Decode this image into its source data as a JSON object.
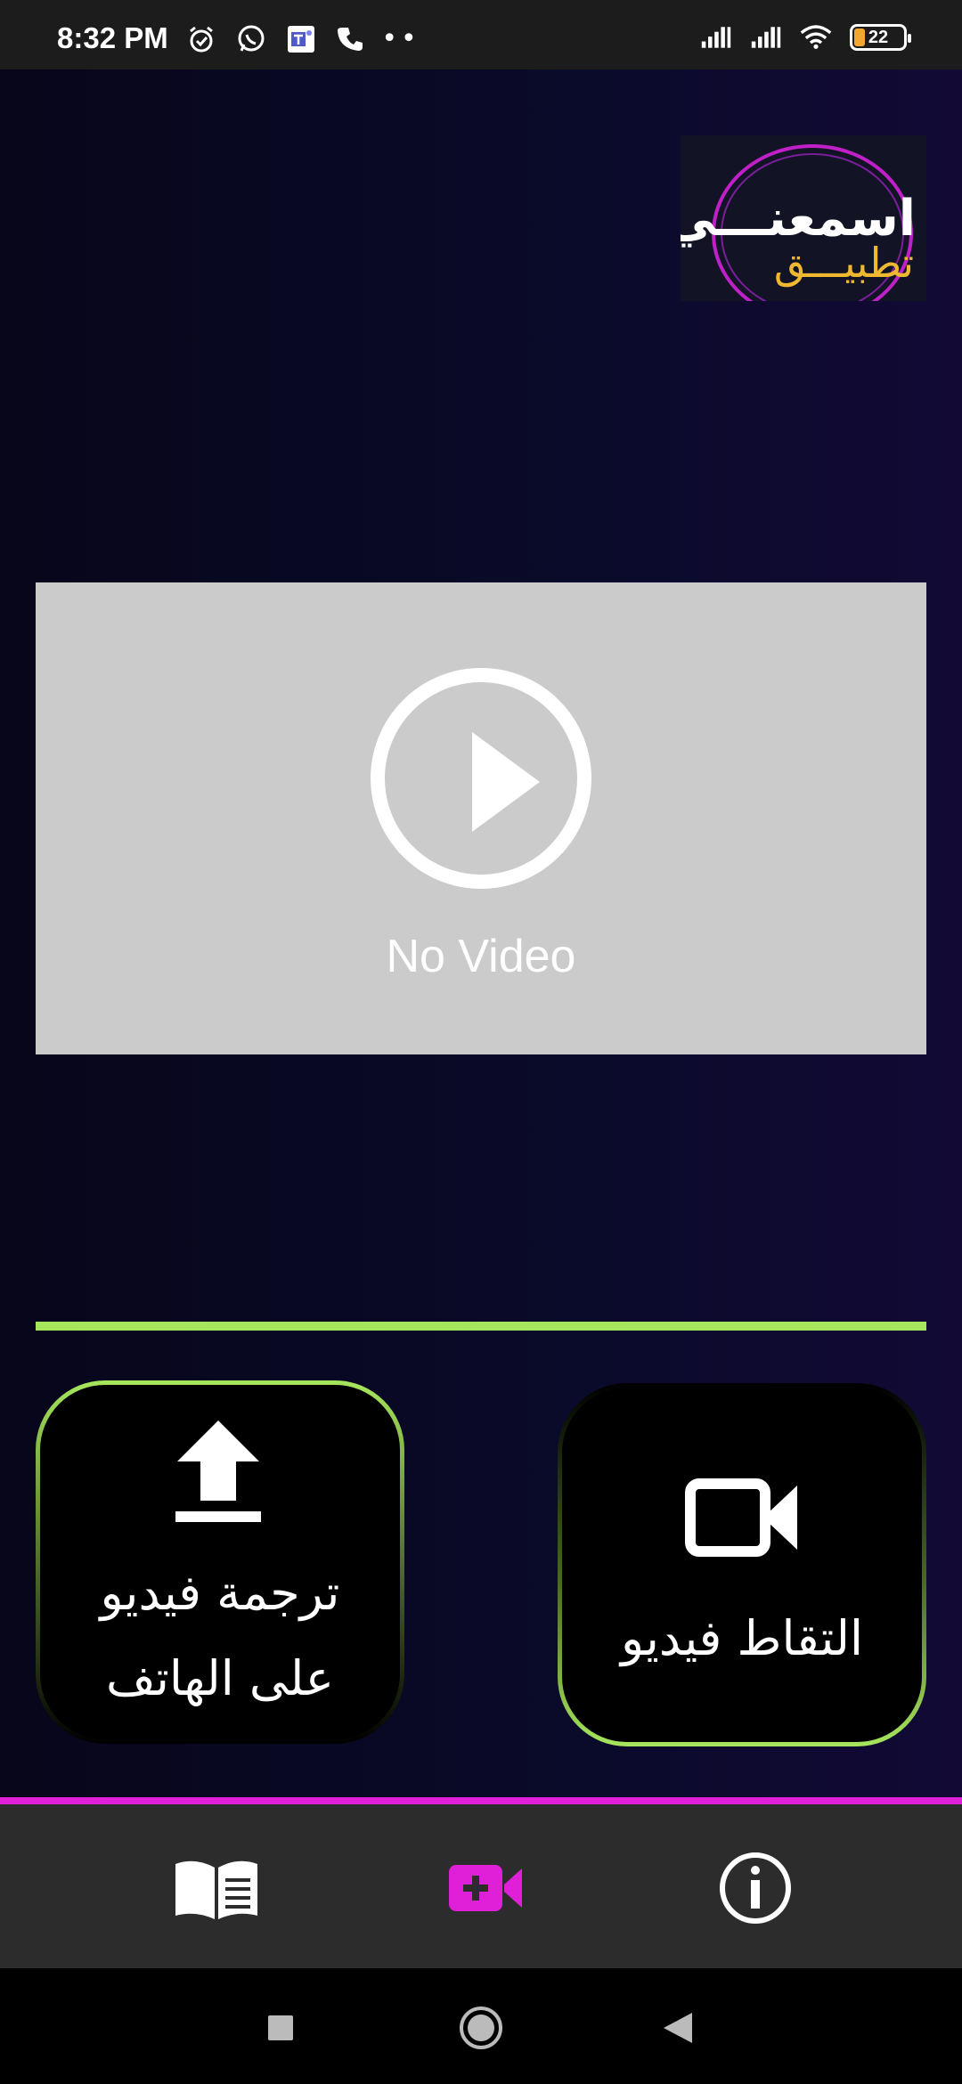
{
  "status_bar": {
    "time": "8:32 PM",
    "battery_level": "22",
    "left_icons": [
      "alarm-icon",
      "whatsapp-icon",
      "teams-icon",
      "phone-icon",
      "more-dots-icon"
    ],
    "right_icons": [
      "signal-icon",
      "signal-icon",
      "wifi-icon",
      "battery-icon"
    ]
  },
  "logo": {
    "line1": "اسمعنـــي",
    "line2": "تطبيـــق"
  },
  "video": {
    "placeholder_text": "No Video",
    "icon": "play-icon"
  },
  "actions": {
    "upload": {
      "label_line1": "ترجمة فيديو",
      "label_line2": "على الهاتف",
      "icon": "upload-icon"
    },
    "capture": {
      "label": "التقاط فيديو",
      "icon": "video-camera-icon"
    }
  },
  "colors": {
    "accent_green": "#a6e65c",
    "accent_magenta": "#e020d8",
    "logo_gold": "#f0b830",
    "video_panel": "#cbcbcb"
  },
  "bottom_nav": {
    "items": [
      {
        "icon": "book-icon",
        "active": false
      },
      {
        "icon": "add-video-icon",
        "active": true
      },
      {
        "icon": "info-icon",
        "active": false
      }
    ]
  },
  "system_nav": [
    "recents-icon",
    "home-icon",
    "back-icon"
  ]
}
